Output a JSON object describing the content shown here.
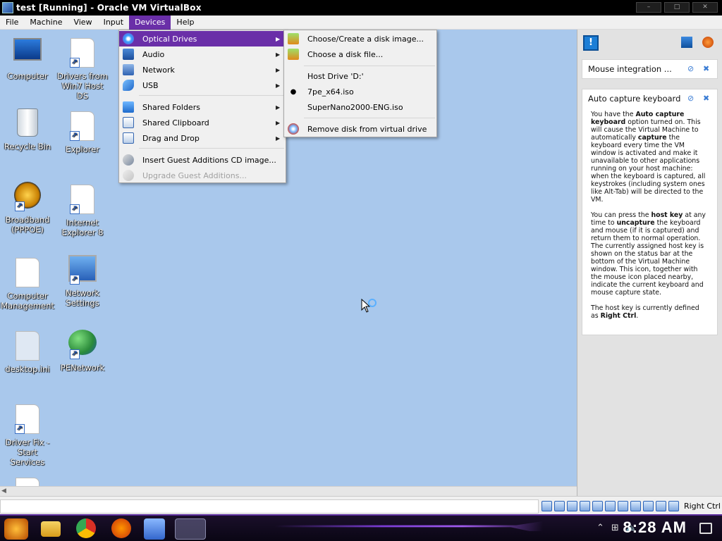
{
  "window": {
    "title": "test [Running] - Oracle VM VirtualBox"
  },
  "menubar": {
    "items": [
      "File",
      "Machine",
      "View",
      "Input",
      "Devices",
      "Help"
    ]
  },
  "desktop_icons": [
    {
      "label": "Computer",
      "icon": "computer-icon"
    },
    {
      "label": "Drivers from Win7 Host DS",
      "icon": "document-shortcut-icon"
    },
    {
      "label": "Recycle Bin",
      "icon": "recycle-bin-icon"
    },
    {
      "label": "Explorer",
      "icon": "document-shortcut-icon"
    },
    {
      "label": "Broadband (PPPOE)",
      "icon": "broadband-icon"
    },
    {
      "label": "Internet Explorer 8",
      "icon": "document-shortcut-icon"
    },
    {
      "label": "Computer Management",
      "icon": "document-icon"
    },
    {
      "label": "Network Settings",
      "icon": "network-settings-icon"
    },
    {
      "label": "desktop.ini",
      "icon": "document-icon"
    },
    {
      "label": "PENetwork",
      "icon": "pe-network-icon"
    },
    {
      "label": "Driver Fix - Start Services",
      "icon": "document-shortcut-icon"
    }
  ],
  "devices_menu": {
    "items": [
      {
        "label": "Optical Drives",
        "icon": "optical-drive-icon",
        "submenu": true,
        "highlighted": true,
        "enabled": true
      },
      {
        "label": "Audio",
        "icon": "audio-icon",
        "submenu": true,
        "highlighted": false,
        "enabled": true
      },
      {
        "label": "Network",
        "icon": "network-icon",
        "submenu": true,
        "highlighted": false,
        "enabled": true
      },
      {
        "label": "USB",
        "icon": "usb-icon",
        "submenu": true,
        "highlighted": false,
        "enabled": true
      },
      {
        "label": "Shared Folders",
        "icon": "shared-folders-icon",
        "submenu": true,
        "highlighted": false,
        "enabled": true
      },
      {
        "label": "Shared Clipboard",
        "icon": "shared-clipboard-icon",
        "submenu": true,
        "highlighted": false,
        "enabled": true
      },
      {
        "label": "Drag and Drop",
        "icon": "drag-and-drop-icon",
        "submenu": true,
        "highlighted": false,
        "enabled": true
      },
      {
        "label": "Insert Guest Additions CD image...",
        "icon": "guest-additions-icon",
        "submenu": false,
        "highlighted": false,
        "enabled": true
      },
      {
        "label": "Upgrade Guest Additions...",
        "icon": "guest-additions-upgrade-icon",
        "submenu": false,
        "highlighted": false,
        "enabled": false
      }
    ]
  },
  "optical_submenu": {
    "items": [
      {
        "label": "Choose/Create a disk image...",
        "icon": "disk-image-icon"
      },
      {
        "label": "Choose a disk file...",
        "icon": "disk-file-icon"
      },
      {
        "label": "Host Drive 'D:'",
        "icon": ""
      },
      {
        "label": "7pe_x64.iso",
        "icon": "selected-bullet-icon",
        "selected": true
      },
      {
        "label": "SuperNano2000-ENG.iso",
        "icon": ""
      },
      {
        "label": "Remove disk from virtual drive",
        "icon": "remove-disk-icon"
      }
    ]
  },
  "side_panel": {
    "card1_title": "Mouse integration ...",
    "card2_title": "Auto capture keyboard ...",
    "para1": {
      "t1": "You have the ",
      "b1": "Auto capture keyboard",
      "t2": " option turned on. This will cause the Virtual Machine to automatically ",
      "b2": "capture",
      "t3": " the keyboard every time the VM window is activated and make it unavailable to other applications running on your host machine: when the keyboard is captured, all keystrokes (including system ones like Alt-Tab) will be directed to the VM."
    },
    "para2": {
      "t1": "You can press the ",
      "b1": "host key",
      "t2": " at any time to ",
      "b2": "uncapture",
      "t3": " the keyboard and mouse (if it is captured) and return them to normal operation. The currently assigned host key is shown on the status bar at the bottom of the Virtual Machine window. This icon, together with the mouse icon placed nearby, indicate the current keyboard and mouse capture state."
    },
    "para3": {
      "t1": "The host key is currently defined as ",
      "b1": "Right Ctrl",
      "t2": "."
    }
  },
  "statusbar": {
    "host_key": "Right Ctrl"
  },
  "taskbar": {
    "clock": "8:28 AM"
  },
  "colors": {
    "menu_highlight": "#6a2fa8",
    "desktop_bg": "#a9c8ec",
    "panel_bg": "#e2e2e2"
  }
}
